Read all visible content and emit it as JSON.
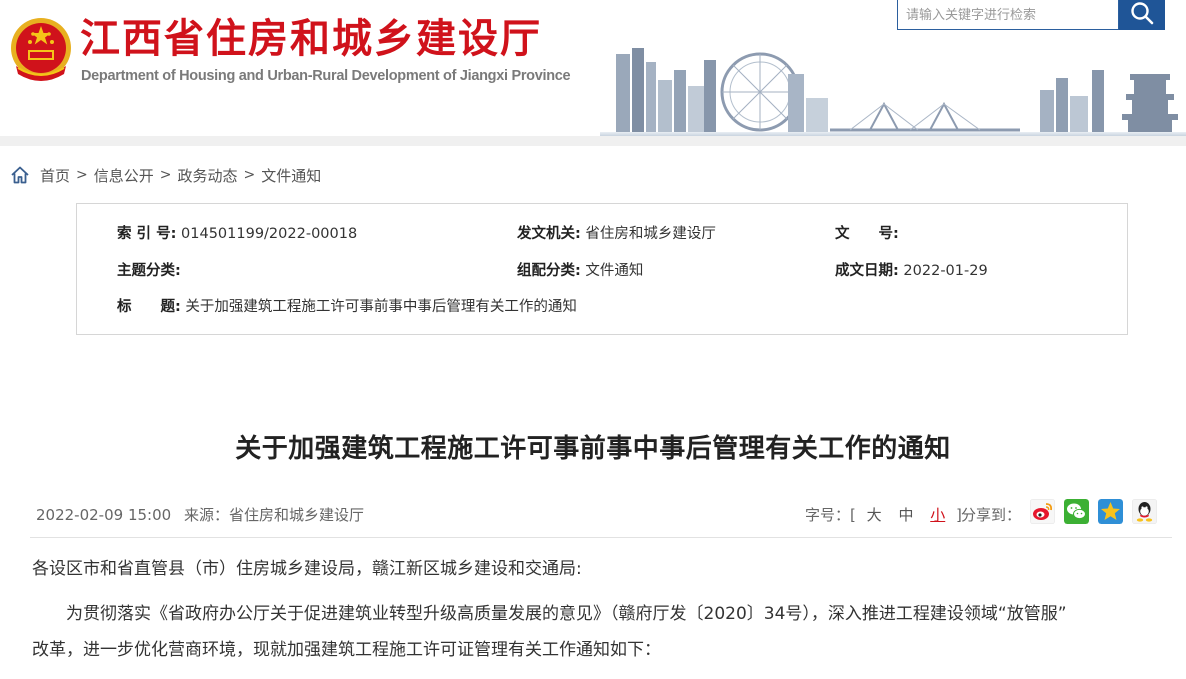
{
  "header": {
    "title": "江西省住房和城乡建设厅",
    "subtitle": "Department of Housing and Urban-Rural Development of Jiangxi Province",
    "search_placeholder": "请输入关键字进行检索",
    "brand_color": "#d0121b",
    "accent_color": "#1f5597",
    "icons": {
      "emblem": "national-emblem-icon",
      "search": "search-icon"
    }
  },
  "breadcrumb": {
    "icon": "home-icon",
    "items": [
      "首页",
      "信息公开",
      "政务动态",
      "文件通知"
    ],
    "separator": ">"
  },
  "info": {
    "index_label": "索 引 号:",
    "index_value": "014501199/2022-00018",
    "issuer_label": "发文机关:",
    "issuer_value": "省住房和城乡建设厅",
    "docno_label": "文　　号:",
    "docno_value": "",
    "topic_label": "主题分类:",
    "topic_value": "",
    "category_label": "组配分类:",
    "category_value": "文件通知",
    "date_label": "成文日期:",
    "date_value": "2022-01-29",
    "title_label": "标　　题:",
    "title_value": "关于加强建筑工程施工许可事前事中事后管理有关工作的通知"
  },
  "article": {
    "title": "关于加强建筑工程施工许可事前事中事后管理有关工作的通知",
    "published": "2022-02-09 15:00",
    "source": "来源：省住房和城乡建设厅",
    "font_size_label": "字号：[",
    "font_sizes": [
      "大",
      "中",
      "小"
    ],
    "font_size_close": "]",
    "share_label": "分享到：",
    "share_icons": [
      "weibo-icon",
      "wechat-icon",
      "qzone-icon",
      "qq-icon"
    ],
    "salutation": "各设区市和省直管县（市）住房城乡建设局，赣江新区城乡建设和交通局:",
    "body_line1": "为贯彻落实《省政府办公厅关于促进建筑业转型升级高质量发展的意见》（赣府厅发〔2020〕34号），深入推进工程建设领域“放管服”",
    "body_line2": "改革，进一步优化营商环境，现就加强建筑工程施工许可证管理有关工作通知如下："
  }
}
